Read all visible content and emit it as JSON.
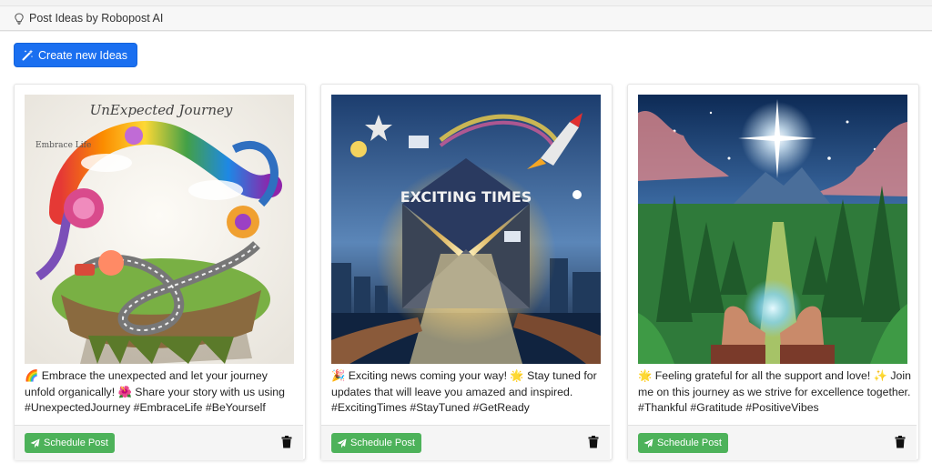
{
  "header": {
    "title": "Post Ideas by Robopost AI",
    "icon": "lightbulb-icon"
  },
  "toolbar": {
    "create_label": "Create new Ideas",
    "create_icon": "magic-wand-icon"
  },
  "colors": {
    "primary": "#1a6ff0",
    "success": "#4db25a"
  },
  "cards": [
    {
      "image_text": "UnExpected Journey",
      "image_side_text": "Embrace Life",
      "caption": "🌈 Embrace the unexpected and let your journey unfold organically! 🌺 Share your story with us using #UnexpectedJourney #EmbraceLife #BeYourself",
      "schedule_label": "Schedule Post"
    },
    {
      "image_text": "EXCITING TIMES",
      "caption": "🎉 Exciting news coming your way! 🌟 Stay tuned for updates that will leave you amazed and inspired. #ExcitingTimes #StayTuned #GetReady",
      "schedule_label": "Schedule Post"
    },
    {
      "caption": "🌟 Feeling grateful for all the support and love! ✨ Join me on this journey as we strive for excellence together. #Thankful #Gratitude #PositiveVibes",
      "schedule_label": "Schedule Post"
    }
  ]
}
